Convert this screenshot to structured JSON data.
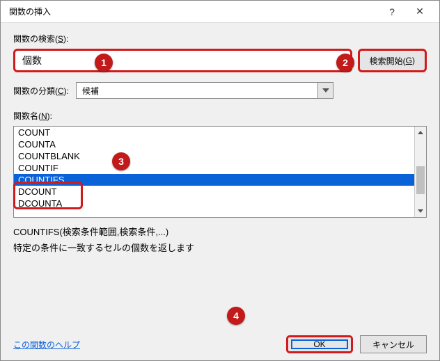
{
  "title": "関数の挿入",
  "search_label_pre": "関数の検索(",
  "search_label_u": "S",
  "search_label_post": "):",
  "search_value": "個数",
  "search_button_pre": "検索開始(",
  "search_button_u": "G",
  "search_button_post": ")",
  "category_label_pre": "関数の分類(",
  "category_label_u": "C",
  "category_label_post": "):",
  "category_value": "候補",
  "funcname_label_pre": "関数名(",
  "funcname_label_u": "N",
  "funcname_label_post": "):",
  "functions": {
    "i0": "COUNT",
    "i1": "COUNTA",
    "i2": "COUNTBLANK",
    "i3": "COUNTIF",
    "i4": "COUNTIFS",
    "i5": "DCOUNT",
    "i6": "DCOUNTA"
  },
  "syntax": "COUNTIFS(検索条件範囲,検索条件,...)",
  "description": "特定の条件に一致するセルの個数を返します",
  "help_link": "この関数のヘルプ",
  "ok_btn": "OK",
  "cancel_btn": "キャンセル",
  "badges": {
    "b1": "1",
    "b2": "2",
    "b3": "3",
    "b4": "4"
  }
}
